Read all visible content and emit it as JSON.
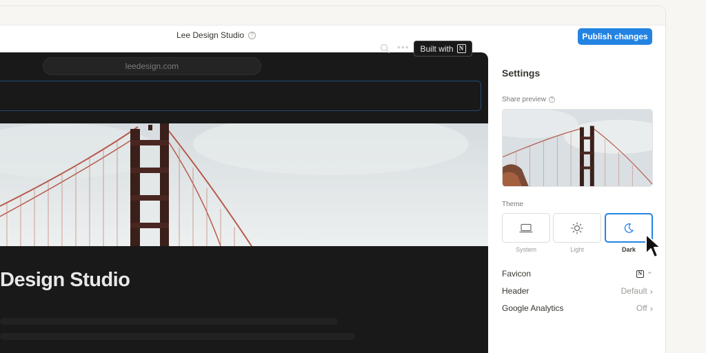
{
  "window": {
    "site_name": "Lee Design Studio",
    "help_icon": "question-circle-icon"
  },
  "toolbar": {
    "publish_label": "Publish changes"
  },
  "preview": {
    "url": "leedesign.com",
    "header": {
      "search_icon": "search-icon",
      "more_icon": "more-dots-icon",
      "more_glyph": "•••",
      "built_with_label": "Built with",
      "notion_glyph": "N"
    },
    "page_title": "Design Studio"
  },
  "settings": {
    "title": "Settings",
    "share_preview_label": "Share preview",
    "theme_label": "Theme",
    "themes": [
      {
        "label": "System",
        "icon": "laptop-icon",
        "active": false
      },
      {
        "label": "Light",
        "icon": "sun-icon",
        "active": false
      },
      {
        "label": "Dark",
        "icon": "moon-icon",
        "active": true
      }
    ],
    "rows": {
      "favicon": {
        "label": "Favicon",
        "value_icon": "notion-logo-icon",
        "chevron": "⌄"
      },
      "header": {
        "label": "Header",
        "value": "Default",
        "chevron": "›"
      },
      "analytics": {
        "label": "Google Analytics",
        "value": "Off",
        "chevron": "›"
      }
    }
  },
  "colors": {
    "accent": "#2383e2",
    "preview_bg": "#191919",
    "text": "#37352f",
    "muted": "#9b9a97"
  }
}
